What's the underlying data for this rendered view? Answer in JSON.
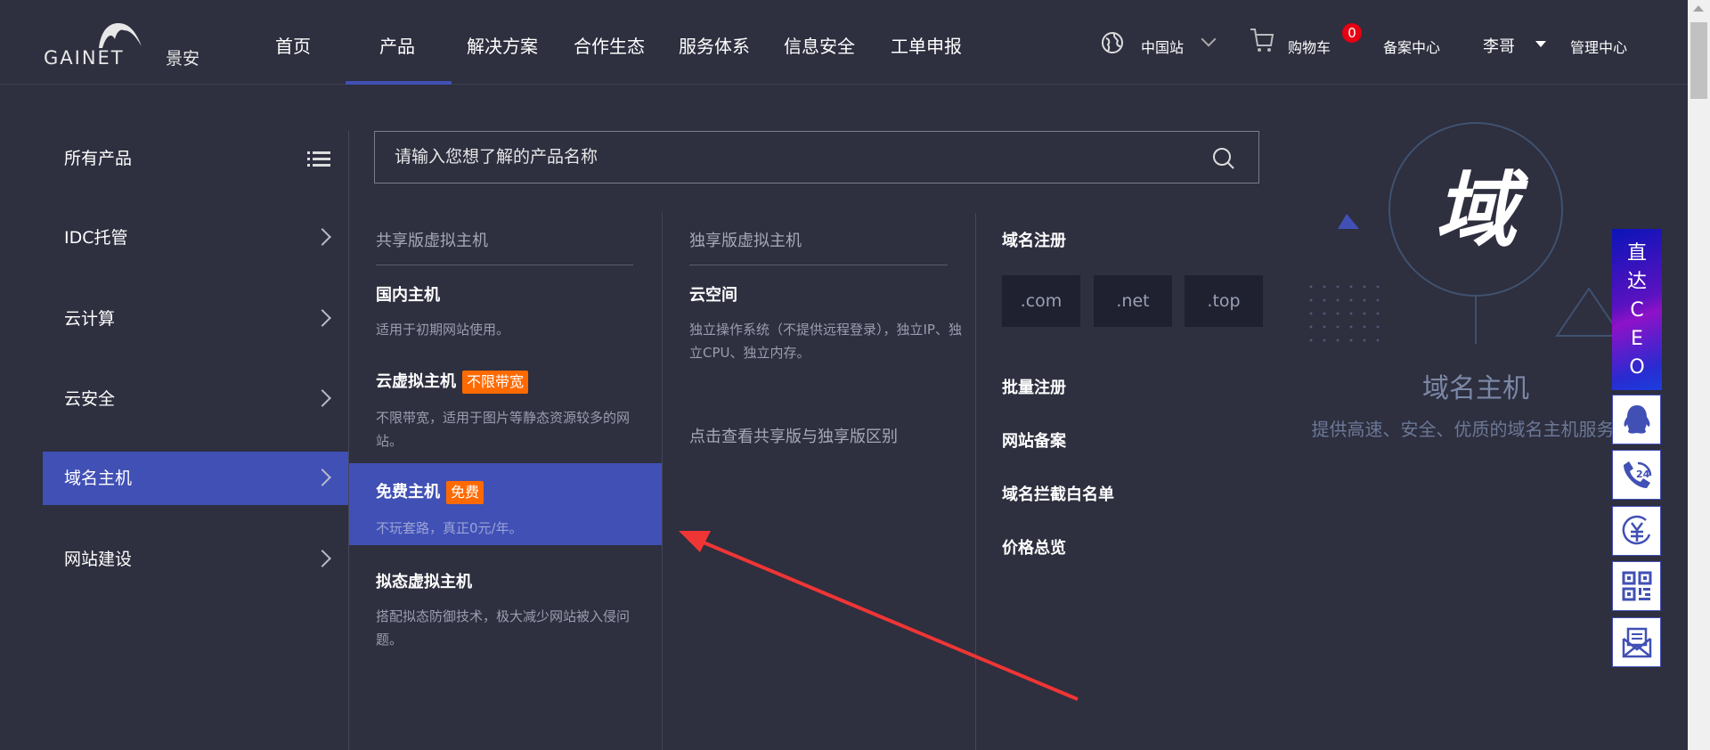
{
  "header": {
    "logo_text": "GAINET景安",
    "nav": [
      "首页",
      "产品",
      "解决方案",
      "合作生态",
      "服务体系",
      "信息安全",
      "工单申报"
    ],
    "active_nav": "产品",
    "site": "中国站",
    "cart": "购物车",
    "cart_count": "0",
    "beian": "备案中心",
    "user": "李哥",
    "admin": "管理中心"
  },
  "sidebar": {
    "all_products": "所有产品",
    "items": [
      "IDC托管",
      "云计算",
      "云安全",
      "域名主机",
      "网站建设"
    ],
    "active": "域名主机"
  },
  "search": {
    "placeholder": "请输入您想了解的产品名称"
  },
  "col1": {
    "header": "共享版虚拟主机",
    "items": [
      {
        "title": "国内主机",
        "desc": "适用于初期网站使用。"
      },
      {
        "title": "云虚拟主机",
        "tag": "不限带宽",
        "desc": "不限带宽，适用于图片等静态资源较多的网站。"
      },
      {
        "title": "免费主机",
        "tag": "免费",
        "desc": "不玩套路，真正0元/年。"
      },
      {
        "title": "拟态虚拟主机",
        "desc": "搭配拟态防御技术，极大减少网站被入侵问题。"
      }
    ]
  },
  "col2": {
    "header": "独享版虚拟主机",
    "items": [
      {
        "title": "云空间",
        "desc": "独立操作系统（不提供远程登录），独立IP、独立CPU、独立内存。"
      }
    ],
    "compare_link": "点击查看共享版与独享版区别"
  },
  "col3": {
    "domain_reg": "域名注册",
    "tlds": [
      ".com",
      ".net",
      ".top"
    ],
    "links": [
      "批量注册",
      "网站备案",
      "域名拦截白名单",
      "价格总览"
    ]
  },
  "feature": {
    "glyph": "域",
    "title": "域名主机",
    "subtitle": "提供高速、安全、优质的域名主机服务"
  },
  "float_bar": {
    "ceo": "直达CEO",
    "icons": [
      "qq-icon",
      "phone-24h-icon",
      "yuan-icon",
      "qr-code-icon",
      "mail-icon"
    ]
  },
  "colors": {
    "bg": "#2e2f3f",
    "accent": "#4150b5",
    "tag": "#ff6a00",
    "badge": "#e60012"
  }
}
